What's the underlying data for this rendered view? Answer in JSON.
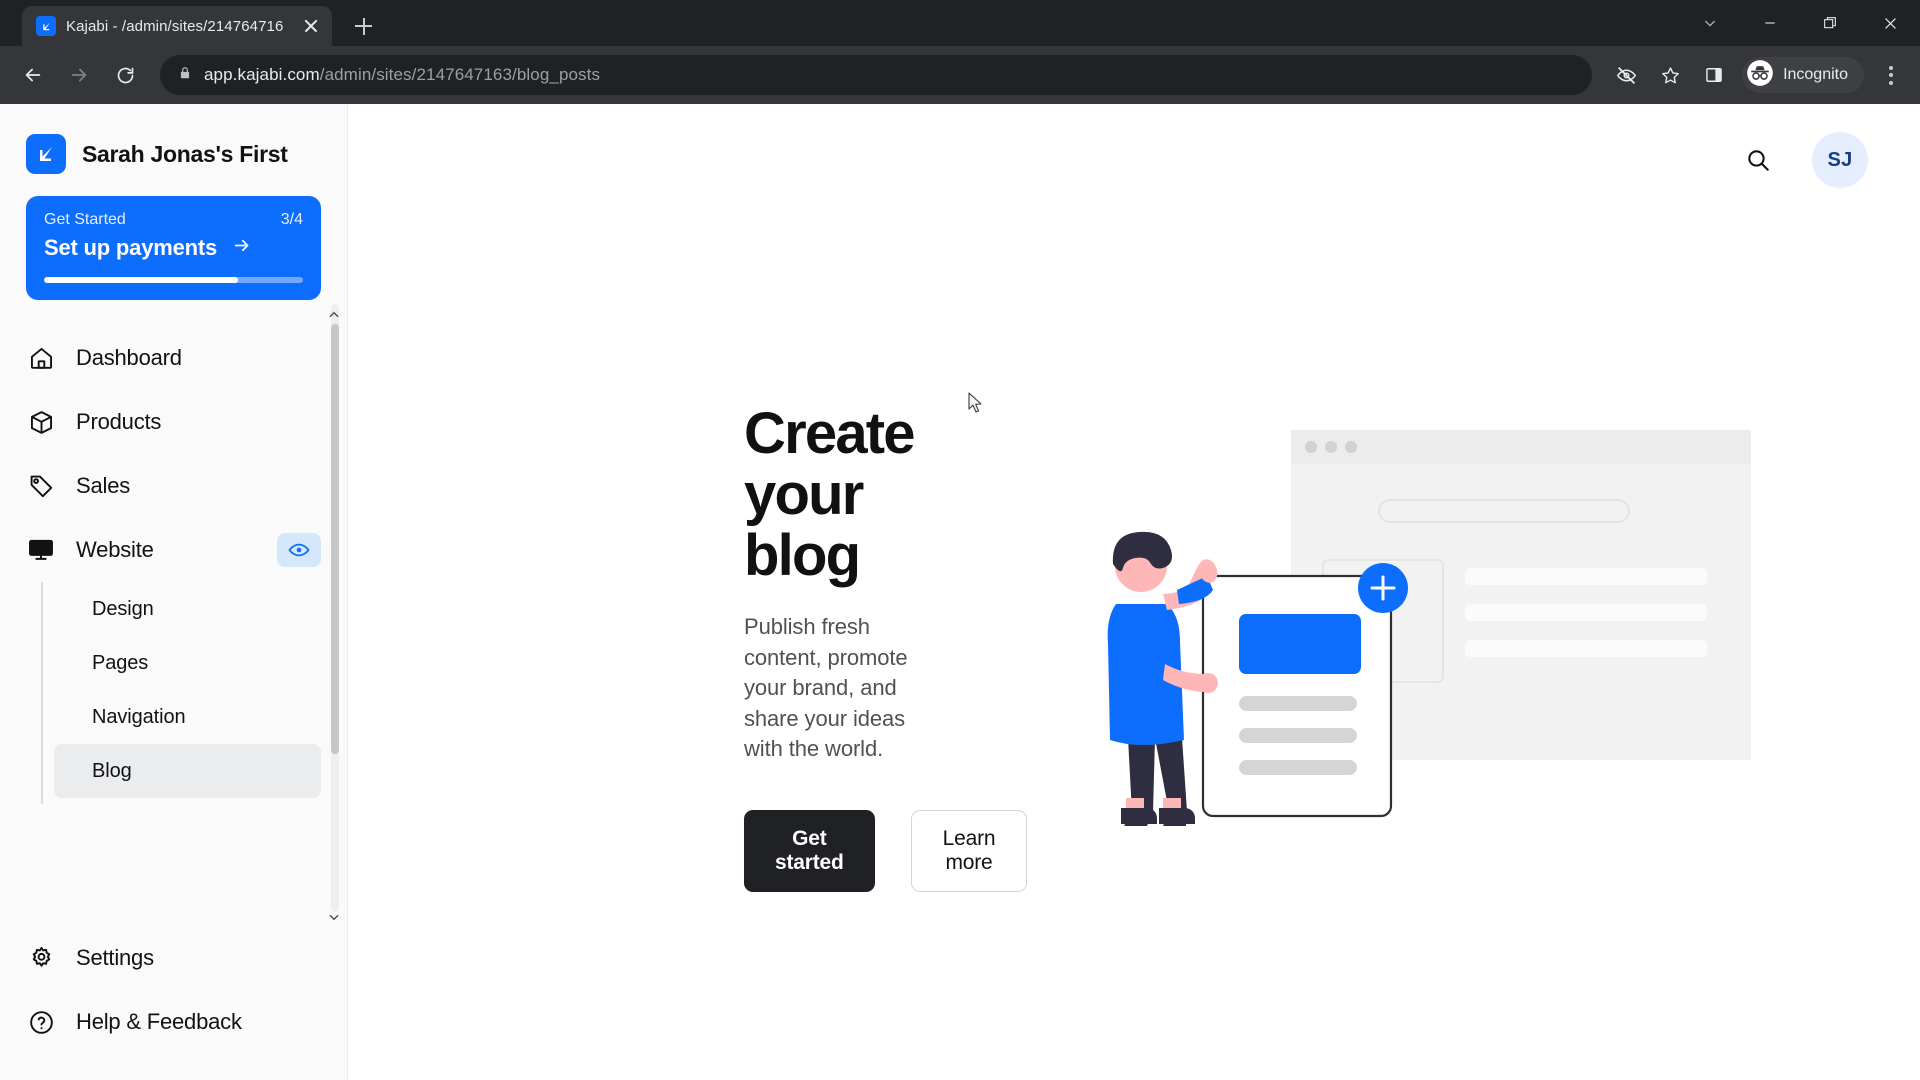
{
  "browser": {
    "tab": {
      "title": "Kajabi - /admin/sites/214764716",
      "favicon": "kajabi-logo-icon"
    },
    "new_tab_label": "+",
    "url_host": "app.kajabi.com",
    "url_path": "/admin/sites/2147647163/blog_posts",
    "profile_label": "Incognito",
    "icons": {
      "back": "back-arrow-icon",
      "forward": "forward-arrow-icon",
      "reload": "reload-icon",
      "lock": "lock-icon",
      "tracking": "eye-slash-icon",
      "bookmark": "star-icon",
      "side_panel": "side-panel-icon",
      "menu": "kebab-menu-icon",
      "tab_search": "chevron-down-icon",
      "minimize": "minimize-icon",
      "maximize": "restore-icon",
      "close": "close-icon"
    }
  },
  "sidebar": {
    "brand": {
      "name": "Sarah Jonas's First",
      "logo": "kajabi-logo-icon"
    },
    "get_started": {
      "label": "Get Started",
      "count": "3/4",
      "task": "Set up payments",
      "arrow": "arrow-right-icon",
      "progress_percent": 75
    },
    "items": [
      {
        "label": "Dashboard",
        "icon": "home-icon"
      },
      {
        "label": "Products",
        "icon": "box-icon"
      },
      {
        "label": "Sales",
        "icon": "tag-icon"
      },
      {
        "label": "Website",
        "icon": "monitor-icon",
        "badge_icon": "eye-icon"
      }
    ],
    "subitems": [
      {
        "label": "Design",
        "active": false
      },
      {
        "label": "Pages",
        "active": false
      },
      {
        "label": "Navigation",
        "active": false
      },
      {
        "label": "Blog",
        "active": true
      }
    ],
    "bottom_items": [
      {
        "label": "Settings",
        "icon": "gear-icon"
      },
      {
        "label": "Help & Feedback",
        "icon": "question-circle-icon"
      }
    ]
  },
  "topbar": {
    "search_icon": "search-icon",
    "avatar_initials": "SJ"
  },
  "hero": {
    "title": "Create your blog",
    "subtitle": "Publish fresh content, promote your brand, and share your ideas with the world.",
    "primary_button": "Get started",
    "secondary_button": "Learn more",
    "illustration": "blog-creation-illustration"
  },
  "colors": {
    "accent": "#0d6efd",
    "dark": "#1f2124",
    "sidebar_bg": "#fafafa",
    "avatar_bg": "#e4eefc",
    "avatar_text": "#1a3f80"
  }
}
